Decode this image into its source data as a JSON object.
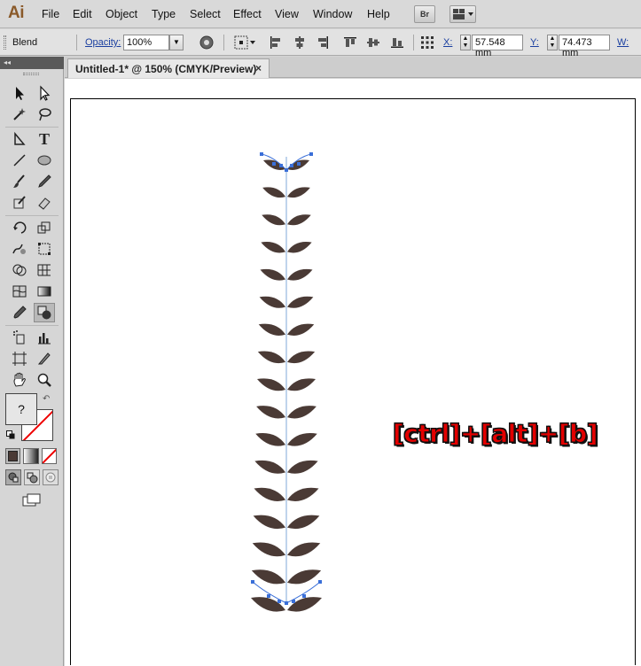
{
  "app": {
    "logo": "Ai",
    "menus": [
      "File",
      "Edit",
      "Object",
      "Type",
      "Select",
      "Effect",
      "View",
      "Window",
      "Help"
    ],
    "bridge_label": "Br"
  },
  "control_bar": {
    "selection_type": "Blend",
    "opacity_label": "Opacity:",
    "opacity_value": "100%",
    "x_label": "X:",
    "x_value": "57.548 mm",
    "y_label": "Y:",
    "y_value": "74.473 mm",
    "w_label": "W:"
  },
  "tools_panel": {
    "collapse_glyph": "◂◂",
    "fill_stroke_question": "?"
  },
  "document": {
    "tab_title": "Untitled-1* @ 150% (CMYK/Preview)",
    "close_glyph": "×"
  },
  "canvas": {
    "leaf_color": "#4a3a35",
    "stem_color": "#7fa9d8",
    "anchor_color": "#3a6fd8",
    "overlay_text": "[ctrl]+[alt]+[b]",
    "overlay_color": "#e30000"
  }
}
